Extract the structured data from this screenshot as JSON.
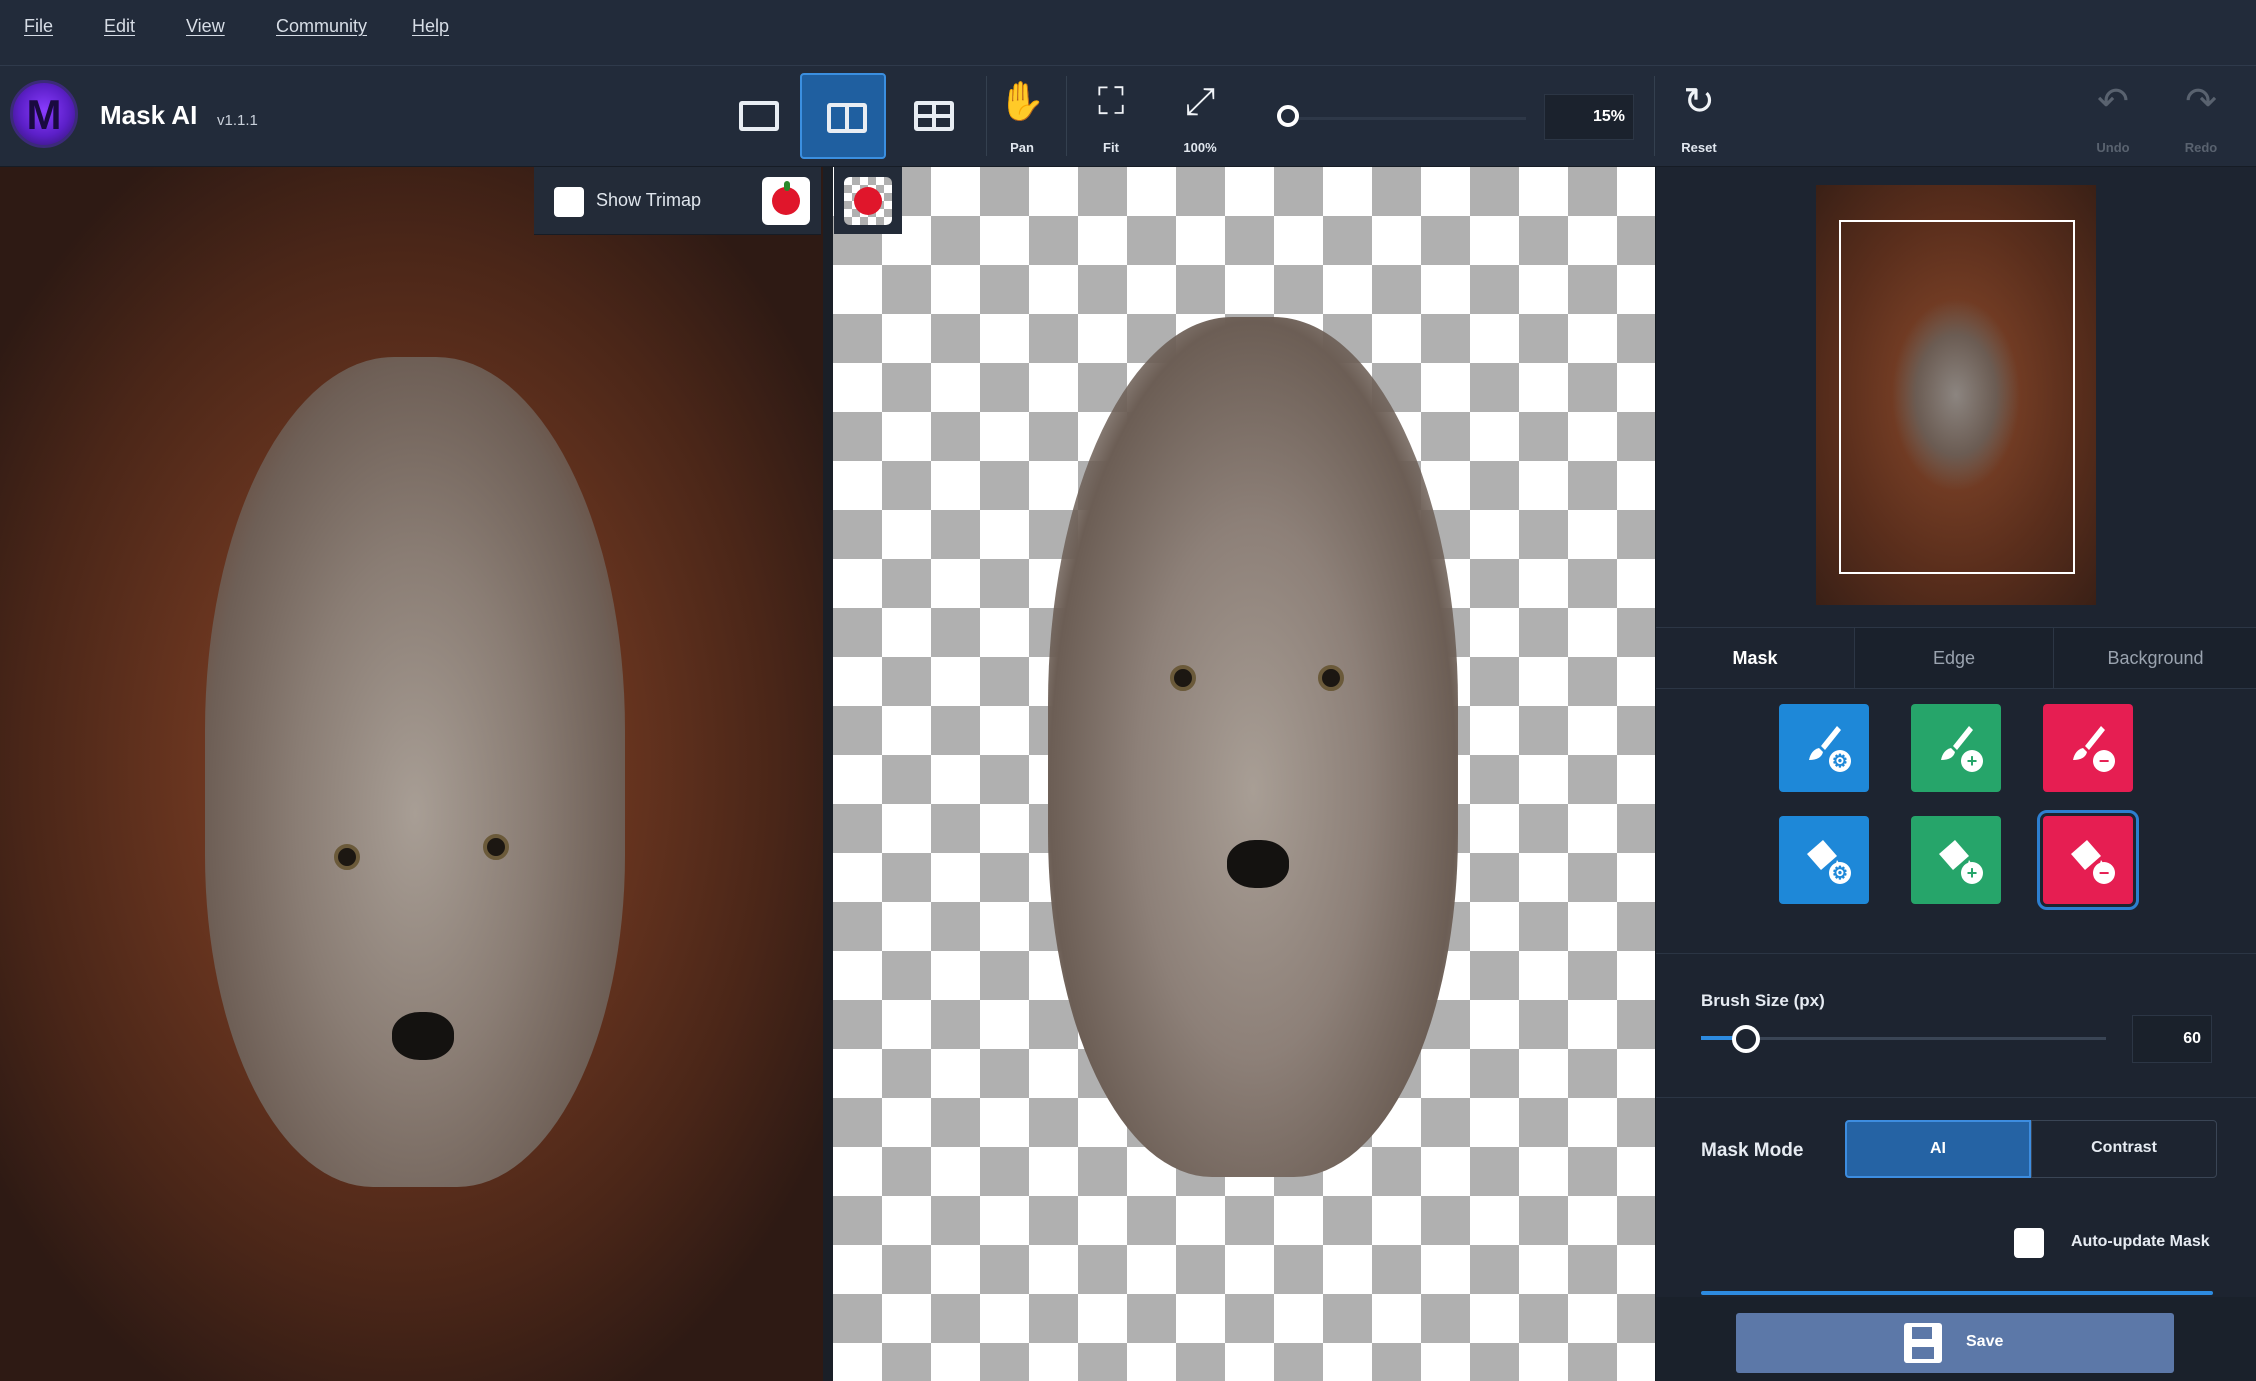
{
  "menu": {
    "file": "File",
    "edit": "Edit",
    "view": "View",
    "community": "Community",
    "help": "Help"
  },
  "app": {
    "logo_letter": "M",
    "title": "Mask AI",
    "version": "v1.1.1"
  },
  "toolbar": {
    "pan": "Pan",
    "fit": "Fit",
    "zoom_100": "100%",
    "zoom_value": "15%",
    "reset": "Reset",
    "undo": "Undo",
    "redo": "Redo"
  },
  "canvas": {
    "show_trimap": "Show Trimap"
  },
  "panel": {
    "tabs": [
      "Mask",
      "Edge",
      "Background"
    ],
    "active_tab": "Mask",
    "brush_size_label": "Brush Size (px)",
    "brush_size_value": "60",
    "brush_size_fraction": 0.11,
    "mask_mode_label": "Mask Mode",
    "mask_mode_ai": "AI",
    "mask_mode_contrast": "Contrast",
    "auto_update_label": "Auto-update Mask",
    "save_label": "Save"
  },
  "colors": {
    "accent_blue": "#1e88d8",
    "keep_green": "#26a56a",
    "cut_red": "#e61e52"
  },
  "icons": {
    "brush_tools": [
      "compute-brush-icon",
      "keep-brush-icon",
      "cut-brush-icon"
    ],
    "fill_tools": [
      "compute-fill-icon",
      "keep-fill-icon",
      "cut-fill-icon"
    ]
  }
}
